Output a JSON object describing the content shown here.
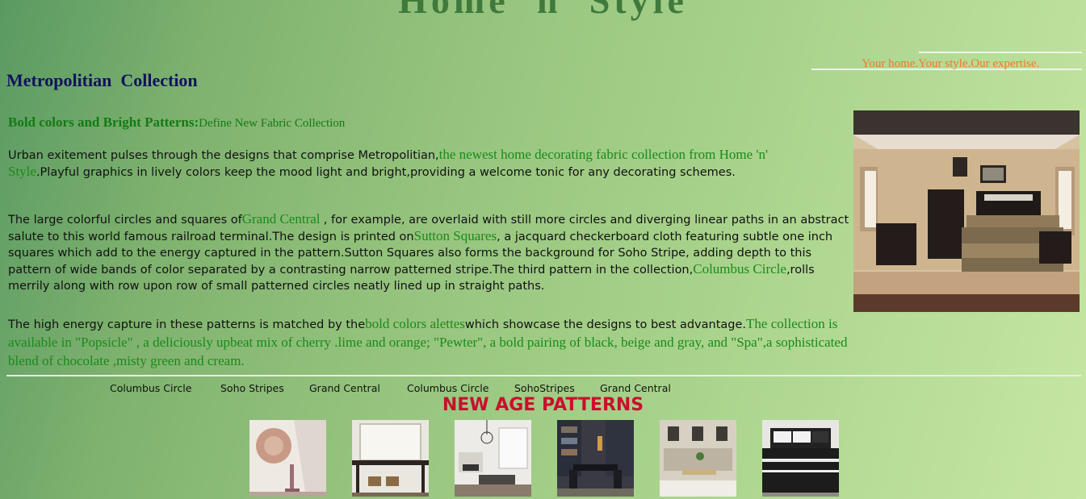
{
  "site": {
    "title": "Home 'n' Style",
    "tagline": "Your home.Your style.Our expertise."
  },
  "section_heading": "Metropolitian  Collection",
  "subheading": {
    "bold": "Bold colors and Bright Patterns:",
    "normal": "Define New Fabric Collection"
  },
  "paragraph1": {
    "t1": "Urban exitement pulses through the designs that comprise Metropolitian,",
    "h1": "the newest home decorating fabric collection from Home 'n' Style",
    "t2": ".Playful graphics in lively colors keep the mood light and bright,providing a welcome tonic for any decorating schemes."
  },
  "paragraph2": {
    "t1": "The large colorful circles and squares of",
    "h1": "Grand Central ",
    "t2": ", for example, are overlaid with still more circles and diverging linear paths in an abstract salute to this world famous railroad terminal.The design is printed on",
    "h2": "Sutton Squares",
    "t3": ", a jacquard checkerboard cloth featuring subtle one inch squares which add to the energy captured in the pattern.Sutton Squares also forms the background for Soho Stripe, adding depth to this pattern of wide bands of color separated by a contrasting narrow patterned stripe.The third pattern in the collection,",
    "h3": "Columbus Circle",
    "t4": ",rolls merrily along with row upon row of small patterned circles neatly lined up in straight paths."
  },
  "paragraph3": {
    "t1": "The high energy capture in these patterns is matched by the",
    "h1": "bold colors alettes",
    "t2": "which showcase the designs to best advantage.",
    "h2": "The collection is available in \"Popsicle\" , a deliciously upbeat mix of cherry .lime and orange; \"Pewter\", a bold pairing of black, beige and gray, and \"Spa\",a sophisticated blend of chocolate ,misty green and cream."
  },
  "nav_links": [
    "Columbus Circle",
    "Soho Stripes",
    "Grand Central",
    "Columbus Circle",
    "SohoStripes",
    "Grand Central"
  ],
  "patterns_title": "NEW AGE PATTERNS",
  "thumbnails": [
    "wall-decor-photo",
    "console-table-photo",
    "living-room-photo",
    "dining-room-photo",
    "sofa-room-photo",
    "black-bedding-photo"
  ],
  "colors": {
    "title": "#3f7a3c",
    "tagline": "#f07a24",
    "heading": "#12125e",
    "highlight": "#1a8a1a",
    "patterns_title": "#c8102e"
  }
}
